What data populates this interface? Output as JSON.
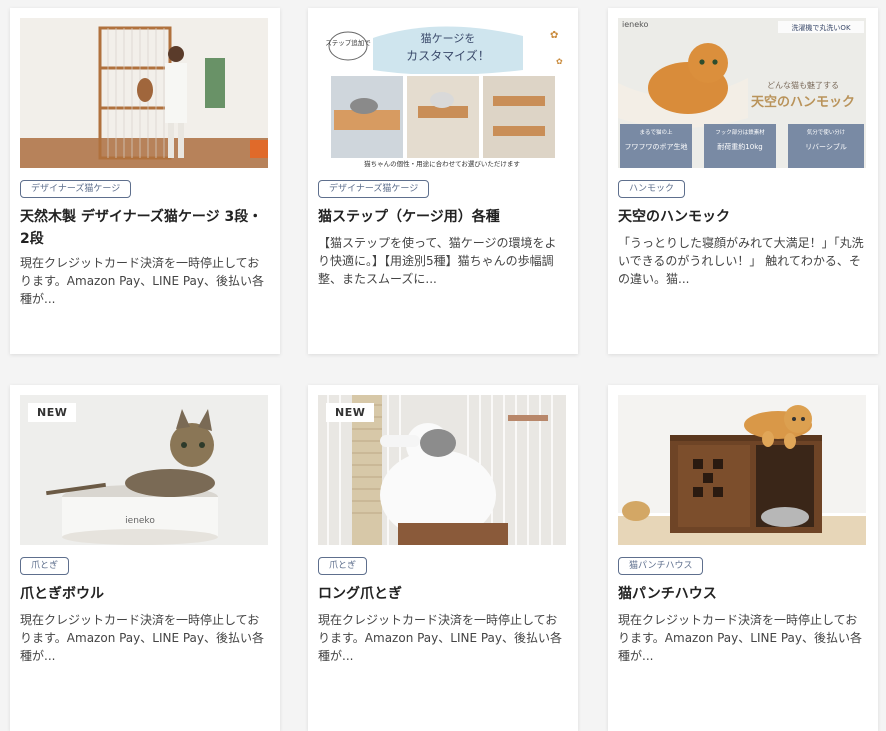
{
  "cards": [
    {
      "category": "デザイナーズ猫ケージ",
      "title": "天然木製 デザイナーズ猫ケージ 3段・2段",
      "excerpt": "現在クレジットカード決済を一時停止しております。Amazon Pay、LINE Pay、後払い各種が...",
      "image": {
        "texts": []
      }
    },
    {
      "category": "デザイナーズ猫ケージ",
      "title": "猫ステップ（ケージ用）各種",
      "excerpt": "【猫ステップを使って、猫ケージの環境をより快適に。】【用途別5種】猫ちゃんの歩幅調整、またスムーズに...",
      "image": {
        "texts": {
          "bubble": "ステップ追加で",
          "headline1": "猫ケージを",
          "headline2": "カスタマイズ！",
          "caption": "猫ちゃんの個性・用途に合わせてお選びいただけます"
        }
      }
    },
    {
      "category": "ハンモック",
      "title": "天空のハンモック",
      "excerpt": "「うっとりした寝顔がみれて大満足！」「丸洗いできるのがうれしい！」 触れてわかる、その違い。猫...",
      "image": {
        "texts": {
          "brand": "ieneko",
          "wash": "洗濯機で丸洗いOK",
          "sub": "どんな猫も魅了する",
          "headline": "天空のハンモック",
          "feat1_label": "まるで猫の上",
          "feat1": "フワフワのボア生地",
          "feat2_label": "フック部分は鉄素材",
          "feat2": "耐荷重約10kg",
          "feat3_label": "気分で使い分け",
          "feat3": "リバーシブル"
        }
      }
    },
    {
      "category": "爪とぎ",
      "title": "爪とぎボウル",
      "excerpt": "現在クレジットカード決済を一時停止しております。Amazon Pay、LINE Pay、後払い各種が...",
      "badge": "NEW",
      "image": {
        "texts": {
          "brand": "ieneko"
        }
      }
    },
    {
      "category": "爪とぎ",
      "title": "ロング爪とぎ",
      "excerpt": "現在クレジットカード決済を一時停止しております。Amazon Pay、LINE Pay、後払い各種が...",
      "badge": "NEW",
      "image": {
        "texts": []
      }
    },
    {
      "category": "猫パンチハウス",
      "title": "猫パンチハウス",
      "excerpt": "現在クレジットカード決済を一時停止しております。Amazon Pay、LINE Pay、後払い各種が...",
      "image": {
        "texts": []
      }
    }
  ],
  "colors": {
    "tag": "#5e6f8d",
    "page_bg": "#f4f4f4",
    "card_bg": "#ffffff"
  }
}
